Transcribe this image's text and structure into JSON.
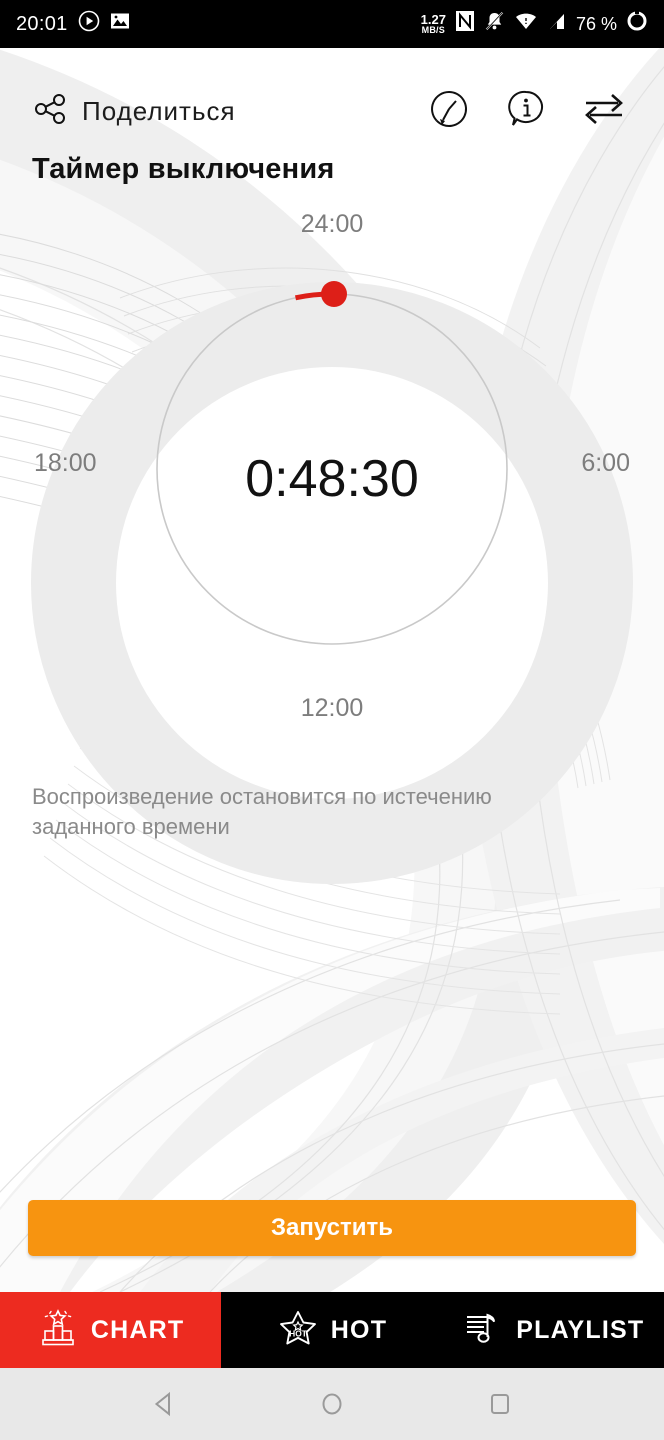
{
  "status_bar": {
    "time": "20:01",
    "net_speed_value": "1.27",
    "net_speed_unit": "MB/S",
    "battery_percent": "76 %",
    "icons": [
      "play-circle-icon",
      "image-icon",
      "nfc-icon",
      "bell-muted-icon",
      "wifi-icon",
      "cellular-signal-icon",
      "battery-ring-icon"
    ]
  },
  "header": {
    "share_label": "Поделиться",
    "share_icon": "share-nodes-icon",
    "actions": [
      {
        "name": "sleep-timer-icon",
        "label": "sleep-timer"
      },
      {
        "name": "info-bubble-icon",
        "label": "info"
      },
      {
        "name": "transfer-arrows-icon",
        "label": "transfer"
      }
    ]
  },
  "page": {
    "title": "Таймер выключения",
    "hint": "Воспроизведение остановится по истечению заданного времени"
  },
  "dial": {
    "center_value": "0:48:30",
    "label_top": "24:00",
    "label_right": "6:00",
    "label_bottom": "12:00",
    "label_left": "18:00",
    "knob_angle_deg": 12,
    "accent_color": "#DD1F18",
    "track_color": "#c9c9c9"
  },
  "cta": {
    "label": "Запустить",
    "color": "#F79410"
  },
  "tabs": [
    {
      "label": "CHART",
      "icon": "podium-star-icon",
      "active": true,
      "active_color": "#ED2B20"
    },
    {
      "label": "HOT",
      "icon": "hot-star-icon",
      "active": false
    },
    {
      "label": "PLAYLIST",
      "icon": "playlist-note-icon",
      "active": false
    }
  ],
  "android_nav": [
    {
      "name": "back-triangle-icon"
    },
    {
      "name": "home-circle-icon"
    },
    {
      "name": "recents-square-icon"
    }
  ]
}
